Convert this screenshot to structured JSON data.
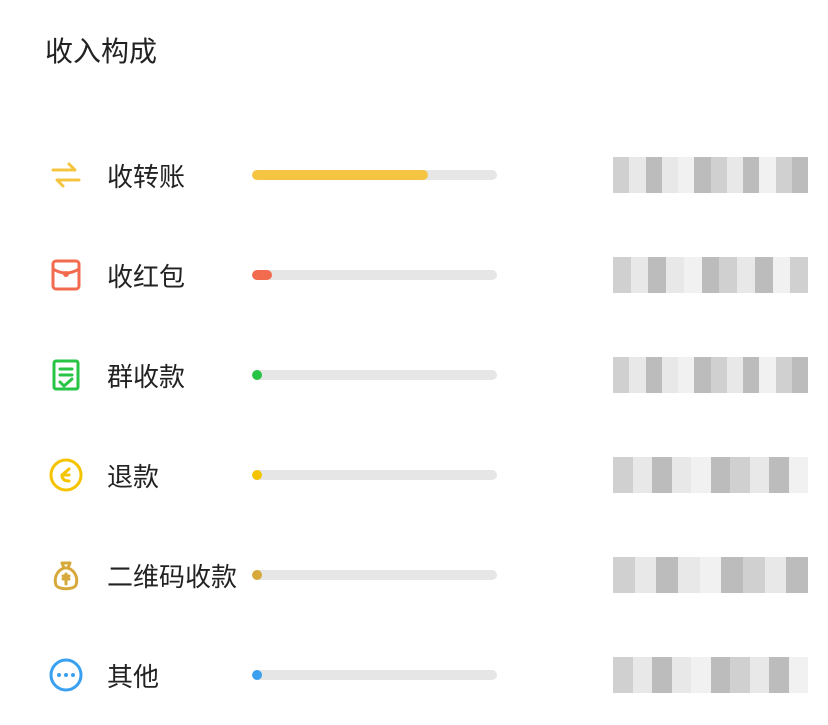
{
  "title": "收入构成",
  "items": [
    {
      "key": "transfer",
      "icon": "transfer-icon",
      "label": "收转账",
      "color": "#f5c542",
      "percent": 72
    },
    {
      "key": "redpacket",
      "icon": "red-packet-icon",
      "label": "收红包",
      "color": "#f26b4e",
      "percent": 8
    },
    {
      "key": "groupcollect",
      "icon": "receipt-icon",
      "label": "群收款",
      "color": "#28c445",
      "percent": 4
    },
    {
      "key": "refund",
      "icon": "refund-icon",
      "label": "退款",
      "color": "#f5c400",
      "percent": 4
    },
    {
      "key": "qrcollect",
      "icon": "money-bag-icon",
      "label": "二维码收款",
      "color": "#d6a93a",
      "percent": 4
    },
    {
      "key": "other",
      "icon": "more-icon",
      "label": "其他",
      "color": "#3aa0f0",
      "percent": 4
    }
  ]
}
